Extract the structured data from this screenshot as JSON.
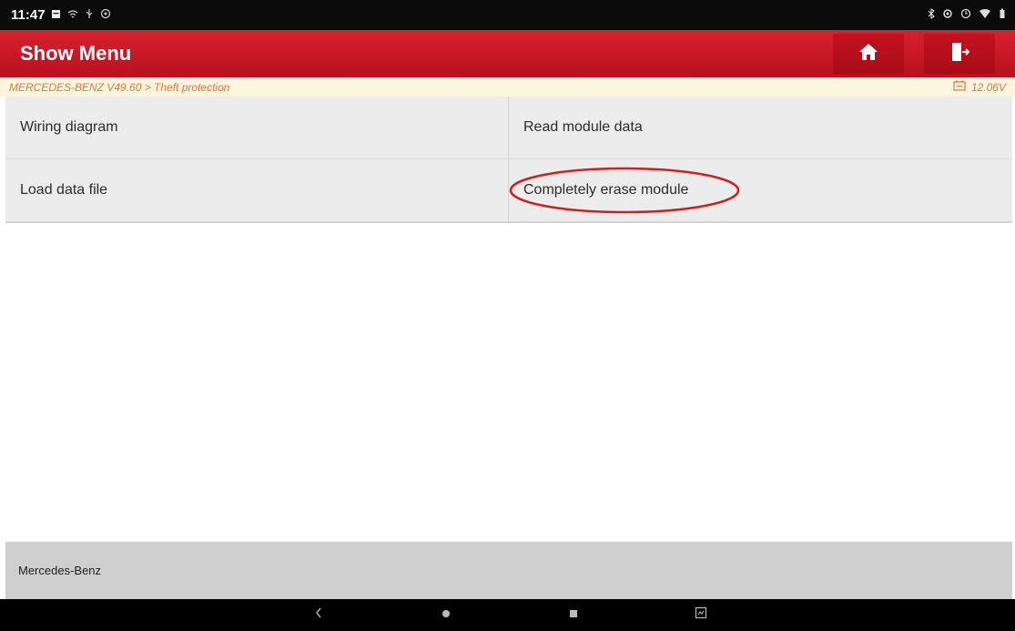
{
  "status": {
    "time": "11:47",
    "left_icons": [
      "notification-square-icon",
      "wifi-signal-icon",
      "usb-icon",
      "settings-icon"
    ],
    "right_icons": [
      "bluetooth-icon",
      "location-icon",
      "alarm-icon",
      "wifi-icon",
      "battery-icon"
    ]
  },
  "header": {
    "title": "Show Menu",
    "buttons": [
      "home-icon",
      "exit-icon"
    ]
  },
  "breadcrumb": {
    "path": "MERCEDES-BENZ V49.60 > Theft protection",
    "voltage": "12.06V"
  },
  "menu": {
    "items": [
      {
        "label": "Wiring diagram"
      },
      {
        "label": "Read module data"
      },
      {
        "label": "Load data file"
      },
      {
        "label": "Completely erase module",
        "highlighted": true
      }
    ]
  },
  "footer": {
    "text": "Mercedes-Benz"
  },
  "nav": {
    "buttons": [
      "back-icon",
      "home-dot-icon",
      "recent-apps-icon",
      "screenshot-icon"
    ]
  },
  "colors": {
    "header_red": "#c8192a",
    "breadcrumb_text": "#e8743f",
    "highlight_ring": "#d11f1f"
  }
}
